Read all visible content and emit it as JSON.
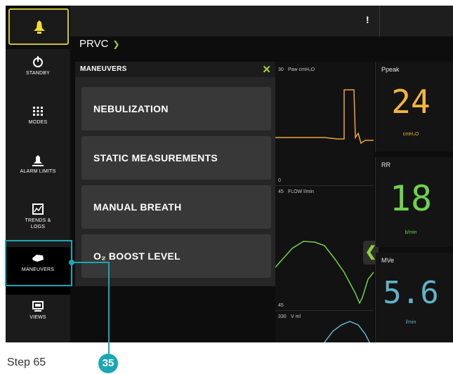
{
  "alarm": {
    "icon": "bell-icon",
    "color": "#f5dd2f",
    "border": "#c9c23a"
  },
  "topbar": {
    "indicator": "!"
  },
  "mode": {
    "name": "PRVC",
    "chevron": "chevron-down-icon",
    "accent": "#9ecf3a"
  },
  "sidebar": {
    "items": [
      {
        "label": "STANDBY",
        "icon": "power-icon"
      },
      {
        "label": "MODES",
        "icon": "grid-icon"
      },
      {
        "label": "ALARM LIMITS",
        "icon": "alarm-limits-icon"
      },
      {
        "label": "TRENDS &\nLOGS",
        "icon": "trends-icon"
      },
      {
        "label": "MANEUVERS",
        "icon": "maneuvers-icon",
        "active": true
      },
      {
        "label": "VIEWS",
        "icon": "views-icon"
      }
    ]
  },
  "panel": {
    "title": "MANEUVERS",
    "close": "✕",
    "buttons": [
      {
        "label": "NEBULIZATION"
      },
      {
        "label": "STATIC MEASUREMENTS"
      },
      {
        "label": "MANUAL BREATH"
      },
      {
        "label": "O₂ BOOST LEVEL"
      }
    ]
  },
  "waveforms": {
    "paw": {
      "scale_top": "30",
      "label": "Paw cmH₂O",
      "scale_bottom": "0",
      "color": "#e9a53a"
    },
    "flow": {
      "scale_top": "45",
      "label": "FLOW l/min",
      "scale_bottom": "45",
      "color": "#6fd14e"
    },
    "volume": {
      "scale_top": "330",
      "label": "V ml",
      "color": "#5fb4c9"
    }
  },
  "values": [
    {
      "name": "Ppeak",
      "value": "24",
      "unit": "cmH₂O",
      "color": "#f3b53c"
    },
    {
      "name": "RR",
      "value": "18",
      "unit": "b/min",
      "color": "#6fd14e"
    },
    {
      "name": "MVe",
      "value": "5.6",
      "unit": "l/min",
      "color": "#5fb4c9"
    }
  ],
  "callout": {
    "number": "35",
    "color": "#1aa6b5"
  },
  "caption": {
    "step": "Step 65"
  }
}
